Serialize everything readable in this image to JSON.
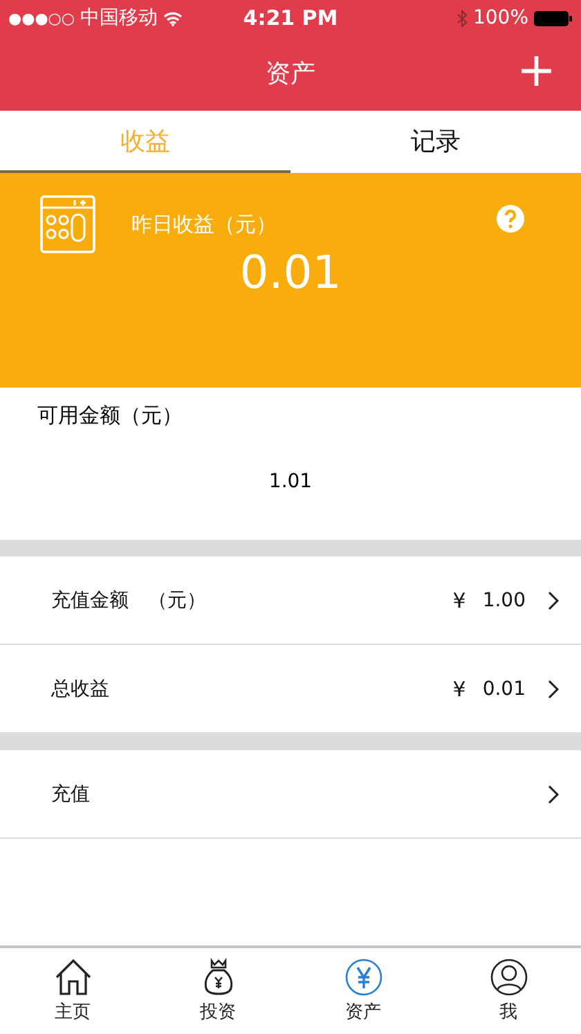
{
  "status_bar": {
    "signal": "●●●○○",
    "carrier": "中国移动",
    "time": "4:21 PM",
    "battery": "100%"
  },
  "nav": {
    "title": "资产",
    "action": "+"
  },
  "tabs": [
    {
      "label": "收益",
      "selected": true
    },
    {
      "label": "记录",
      "selected": false
    }
  ],
  "earnings_card": {
    "label": "昨日收益（元）",
    "value": "0.01"
  },
  "available": {
    "label": "可用金额（元）",
    "value": "1.01"
  },
  "groups": [
    [
      {
        "label": "充值金额　（元）",
        "currency": "¥",
        "value": "1.00"
      },
      {
        "label": "总收益",
        "currency": "¥",
        "value": "0.01"
      }
    ],
    [
      {
        "label": "充值"
      }
    ]
  ],
  "tab_bar": [
    {
      "label": "主页",
      "kind": "home",
      "selected": false
    },
    {
      "label": "投资",
      "kind": "bag",
      "selected": false
    },
    {
      "label": "资产",
      "kind": "yen",
      "selected": true
    },
    {
      "label": "我",
      "kind": "user",
      "selected": false
    }
  ]
}
